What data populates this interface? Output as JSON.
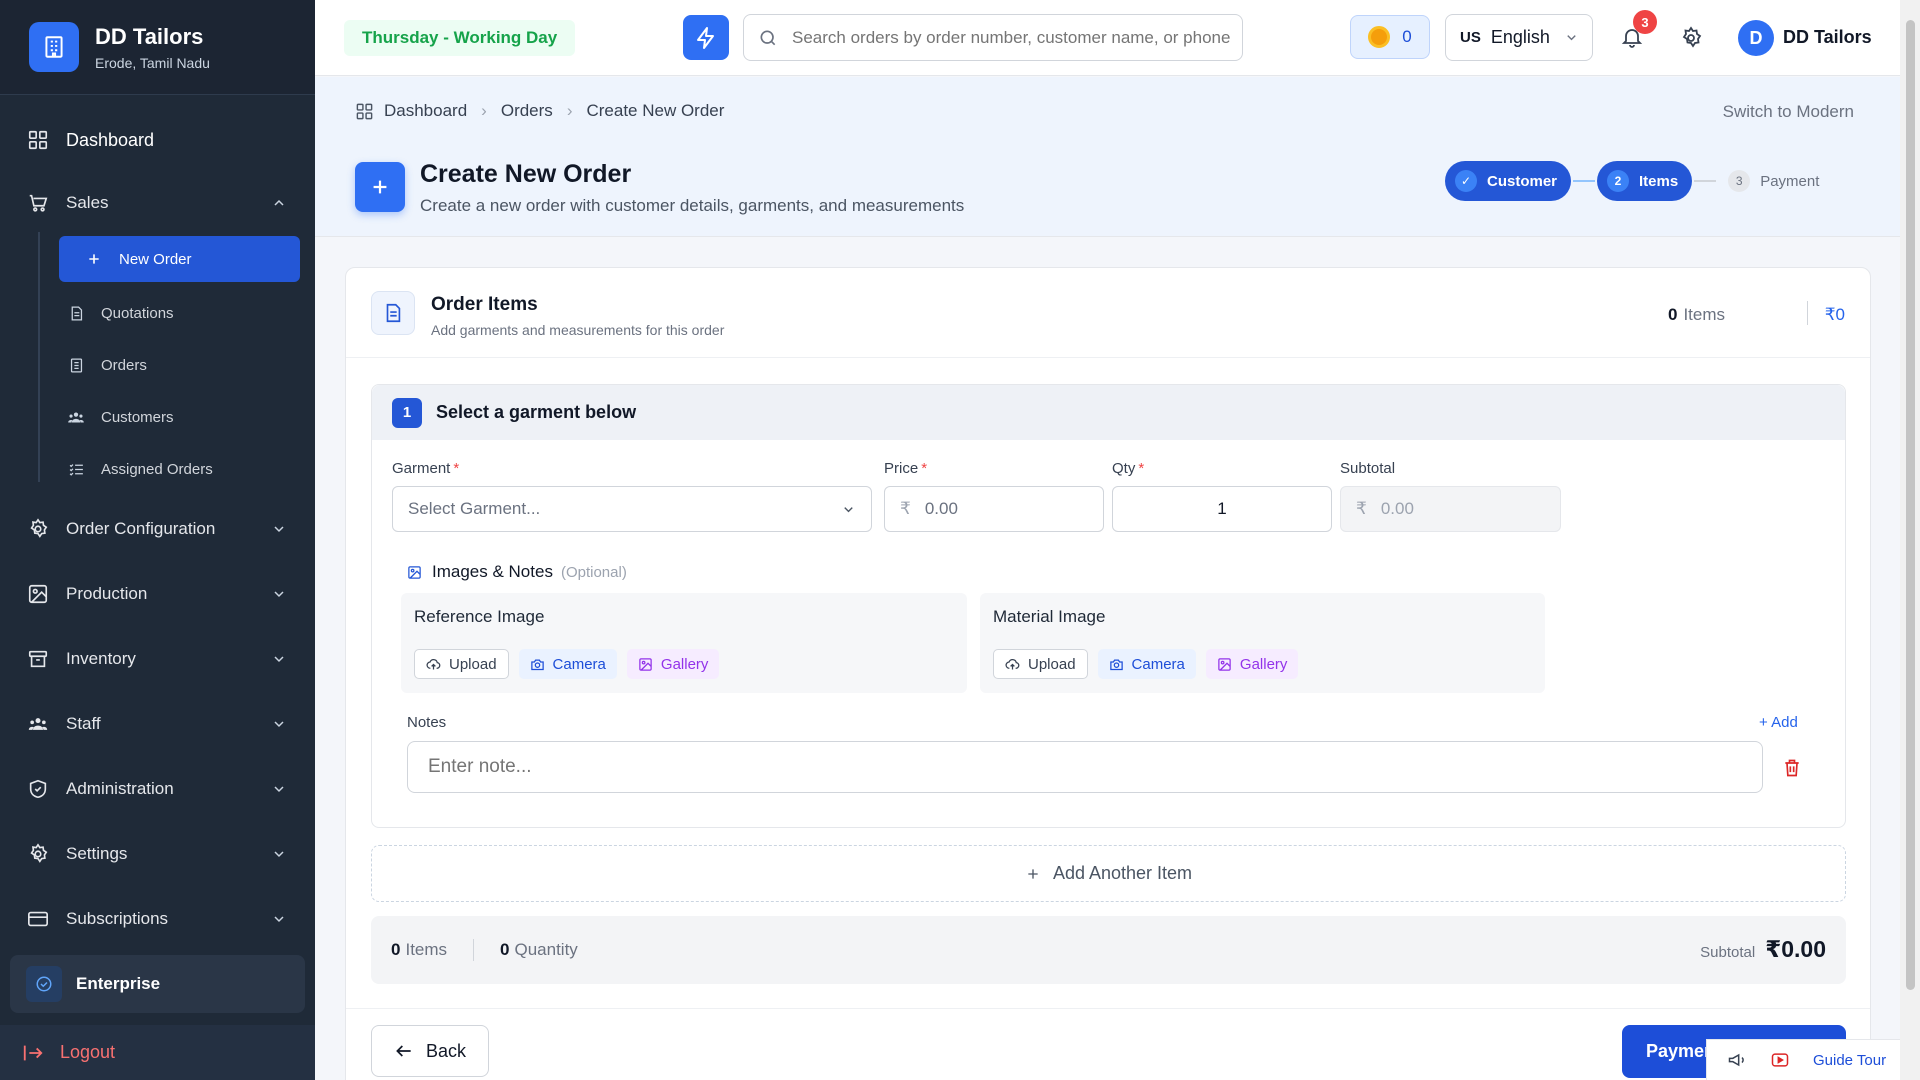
{
  "brand": {
    "name": "DD Tailors",
    "location": "Erode, Tamil Nadu",
    "logo_icon": "building-icon"
  },
  "sidebar": {
    "dashboard": "Dashboard",
    "sales": "Sales",
    "sales_items": [
      {
        "label": "New Order",
        "icon": "plus-icon",
        "active": true
      },
      {
        "label": "Quotations",
        "icon": "document-icon"
      },
      {
        "label": "Orders",
        "icon": "list-icon"
      },
      {
        "label": "Customers",
        "icon": "users-icon"
      },
      {
        "label": "Assigned Orders",
        "icon": "checklist-icon"
      }
    ],
    "sections": [
      "Order Configuration",
      "Production",
      "Inventory",
      "Staff",
      "Administration",
      "Settings",
      "Subscriptions"
    ],
    "plan": "Enterprise",
    "logout": "Logout"
  },
  "topbar": {
    "day_status": "Thursday - Working Day",
    "search_placeholder": "Search orders by order number, customer name, or phone",
    "coins": "0",
    "lang_code": "US",
    "language": "English",
    "notifications": "3",
    "avatar_initial": "D",
    "user_name": "DD Tailors"
  },
  "breadcrumb": [
    "Dashboard",
    "Orders",
    "Create New Order"
  ],
  "switch_label": "Switch to Modern",
  "page": {
    "title": "Create New Order",
    "subtitle": "Create a new order with customer details, garments, and measurements"
  },
  "stepper": [
    {
      "num": "✓",
      "label": "Customer",
      "state": "done"
    },
    {
      "num": "2",
      "label": "Items",
      "state": "current"
    },
    {
      "num": "3",
      "label": "Payment",
      "state": "pending"
    }
  ],
  "card": {
    "title": "Order Items",
    "subtitle": "Add garments and measurements for this order",
    "items_count": "0",
    "items_label": "Items",
    "total": "₹0"
  },
  "item": {
    "number": "1",
    "heading": "Select a garment below",
    "garment_label": "Garment",
    "garment_placeholder": "Select Garment...",
    "price_label": "Price",
    "price_value": "0.00",
    "qty_label": "Qty",
    "qty_value": "1",
    "subtotal_label": "Subtotal",
    "subtotal_value": "0.00",
    "currency": "₹",
    "images_notes": "Images & Notes",
    "optional": "(Optional)",
    "reference_image": "Reference Image",
    "material_image": "Material Image",
    "upload": "Upload",
    "camera": "Camera",
    "gallery": "Gallery",
    "notes_label": "Notes",
    "add_note": "+ Add",
    "note_placeholder": "Enter note..."
  },
  "add_another": "Add Another Item",
  "summary": {
    "items_count": "0",
    "items_label": "Items",
    "qty_count": "0",
    "qty_label": "Quantity",
    "subtotal_label": "Subtotal",
    "subtotal_value": "₹0.00"
  },
  "footer": {
    "back": "Back",
    "next": "Payment"
  },
  "guide": {
    "label": "Guide Tour"
  },
  "colors": {
    "primary": "#2457d6",
    "sidebar": "#1f2a38",
    "success": "#16a34a",
    "danger": "#ef4444"
  }
}
